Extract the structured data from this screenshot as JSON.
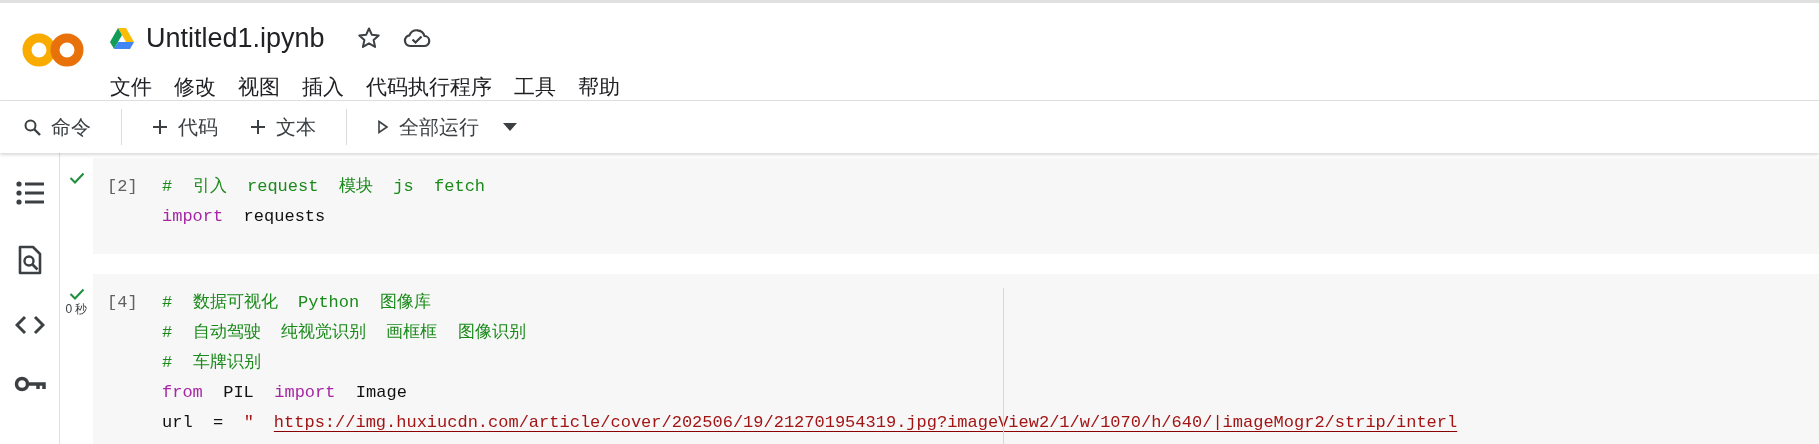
{
  "header": {
    "title": "Untitled1.ipynb",
    "starred": false,
    "menu": [
      "文件",
      "修改",
      "视图",
      "插入",
      "代码执行程序",
      "工具",
      "帮助"
    ]
  },
  "toolbar": {
    "items": [
      {
        "kind": "search",
        "label": "命令"
      },
      {
        "kind": "add",
        "label": "代码"
      },
      {
        "kind": "add",
        "label": "文本"
      },
      {
        "kind": "run",
        "label": "全部运行"
      }
    ]
  },
  "cells": [
    {
      "count": "[2]",
      "succeeded": true,
      "lines": [
        [
          {
            "kind": "comment",
            "text": "#  引入  request  模块  js  fetch"
          }
        ],
        [
          {
            "kind": "keyword",
            "text": "import"
          },
          {
            "kind": "plain",
            "text": "  requests"
          }
        ]
      ]
    },
    {
      "count": "[4]",
      "succeeded": true,
      "time": "0 秒",
      "ruler": true,
      "lines": [
        [
          {
            "kind": "comment",
            "text": "#  数据可视化  Python  图像库"
          }
        ],
        [
          {
            "kind": "comment",
            "text": "#  自动驾驶  纯视觉识别  画框框  图像识别"
          }
        ],
        [
          {
            "kind": "comment",
            "text": "#  车牌识别"
          }
        ],
        [
          {
            "kind": "keyword",
            "text": "from"
          },
          {
            "kind": "plain",
            "text": "  PIL  "
          },
          {
            "kind": "keyword",
            "text": "import"
          },
          {
            "kind": "plain",
            "text": "  Image"
          }
        ],
        [
          {
            "kind": "plain",
            "text": "url  =  "
          },
          {
            "kind": "string",
            "text": "″"
          },
          {
            "kind": "link",
            "text": "https://img.huxiucdn.com/article/cover/202506/19/212701954319.jpg?imageView2/1/w/1070/h/640/|imageMogr2/strip/interl"
          }
        ]
      ]
    }
  ]
}
